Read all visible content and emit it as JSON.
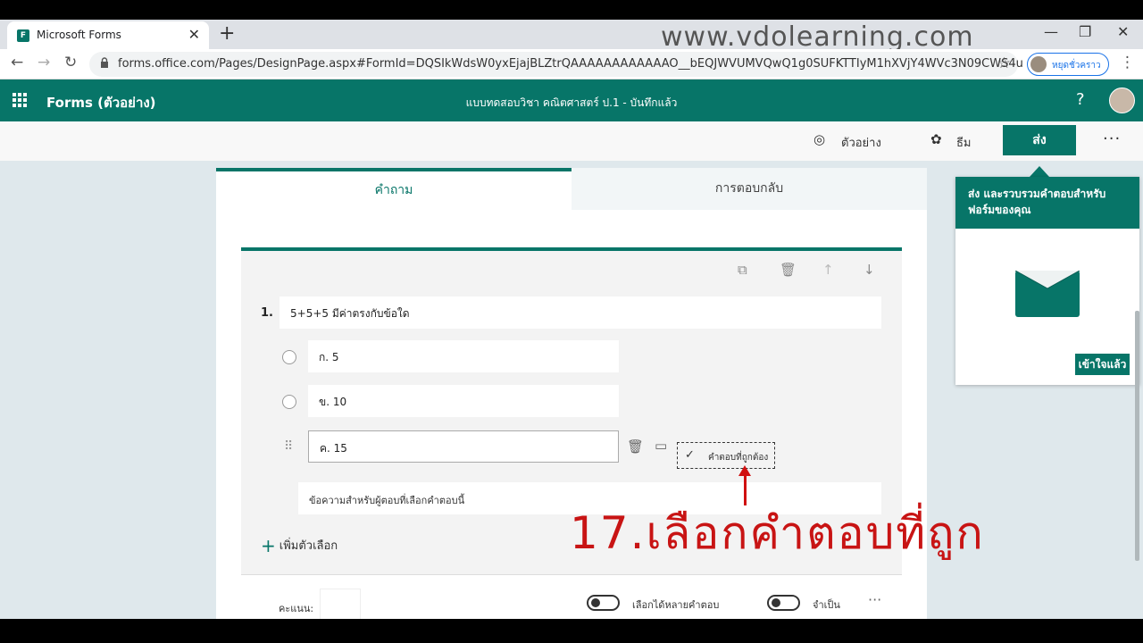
{
  "browser": {
    "tab_title": "Microsoft Forms",
    "tab_favicon_letter": "F",
    "tab_close": "✕",
    "new_tab": "+",
    "watermark": "www.vdolearning.com",
    "win_min": "—",
    "win_restore": "❐",
    "win_close": "✕",
    "back": "←",
    "forward": "→",
    "reload": "↻",
    "url": "forms.office.com/Pages/DesignPage.aspx#FormId=DQSIkWdsW0yxEjajBLZtrQAAAAAAAAAAAAO__bEQJWVUMVQwQ1g0SUFKTTIyM1hXVjY4WVc3N09CWS4u",
    "star": "☆",
    "profile_label": "หยุดชั่วคราว",
    "kebab": "⋮"
  },
  "header": {
    "app_name": "Forms (ตัวอย่าง)",
    "doc_title": "แบบทดสอบวิชา คณิตศาสตร์ ป.1 - บันทึกแล้ว",
    "help": "?"
  },
  "toolbar": {
    "preview_icon": "◎",
    "preview": "ตัวอย่าง",
    "theme_icon": "✿",
    "theme": "ธีม",
    "send": "ส่ง",
    "more": "···"
  },
  "tabs": {
    "questions": "คำถาม",
    "responses": "การตอบกลับ"
  },
  "question": {
    "number": "1.",
    "text": "5+5+5 มีค่าตรงกับข้อใด",
    "tools": {
      "copy": "⧉",
      "delete": "🗑",
      "up": "↑",
      "down": "↓"
    },
    "options": [
      {
        "label": "ก. 5"
      },
      {
        "label": "ข. 10"
      },
      {
        "label": "ค. 15"
      }
    ],
    "drag_handle": "⠿",
    "option_delete": "🗑",
    "option_comment": "▭",
    "correct_check": "✓",
    "correct_answer_label": "คำตอบที่ถูกต้อง",
    "feedback_placeholder": "ข้อความสำหรับผู้ตอบที่เลือกคำตอบนี้",
    "add_option_plus": "+",
    "add_option": "เพิ่มตัวเลือก",
    "score_label": "คะแนน:",
    "multi_answer": "เลือกได้หลายคำตอบ",
    "required": "จำเป็น",
    "more": "···"
  },
  "popover": {
    "heading": "ส่ง และรวบรวมคำตอบสำหรับฟอร์มของคุณ",
    "ok": "เข้าใจแล้ว"
  },
  "annotation": {
    "text": "17.เลือกคำตอบที่ถูก"
  },
  "colors": {
    "brand": "#077568",
    "annotation": "#c81414"
  }
}
